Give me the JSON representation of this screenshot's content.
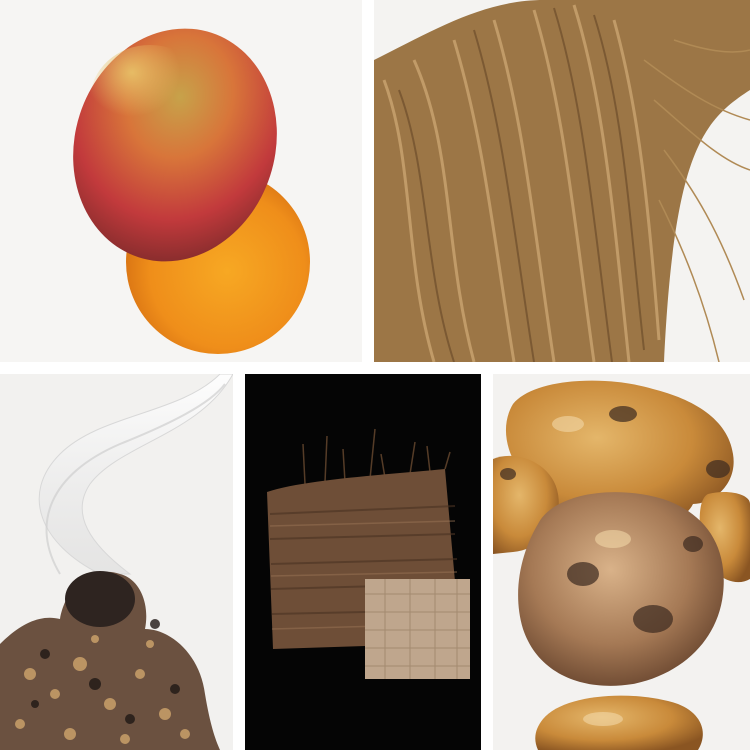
{
  "panels": [
    {
      "subject": "mango-and-mango-slice"
    },
    {
      "subject": "vetiver-roots"
    },
    {
      "subject": "smoking-resin-incense"
    },
    {
      "subject": "papyrus-sheets"
    },
    {
      "subject": "amber-resin-stones"
    }
  ],
  "colors": {
    "background": "#ffffff",
    "panel_light": "#f4f3f1",
    "panel_dark": "#050505",
    "mango_red": "#c8373d",
    "mango_yellow": "#e3a03d",
    "mango_slice": "#f39b1f",
    "root_tan": "#b08a55",
    "papyrus_brown": "#7a5a3f",
    "papyrus_light": "#c9b29a",
    "resin_amber": "#c98a3a",
    "resin_dark": "#3c2a20"
  }
}
